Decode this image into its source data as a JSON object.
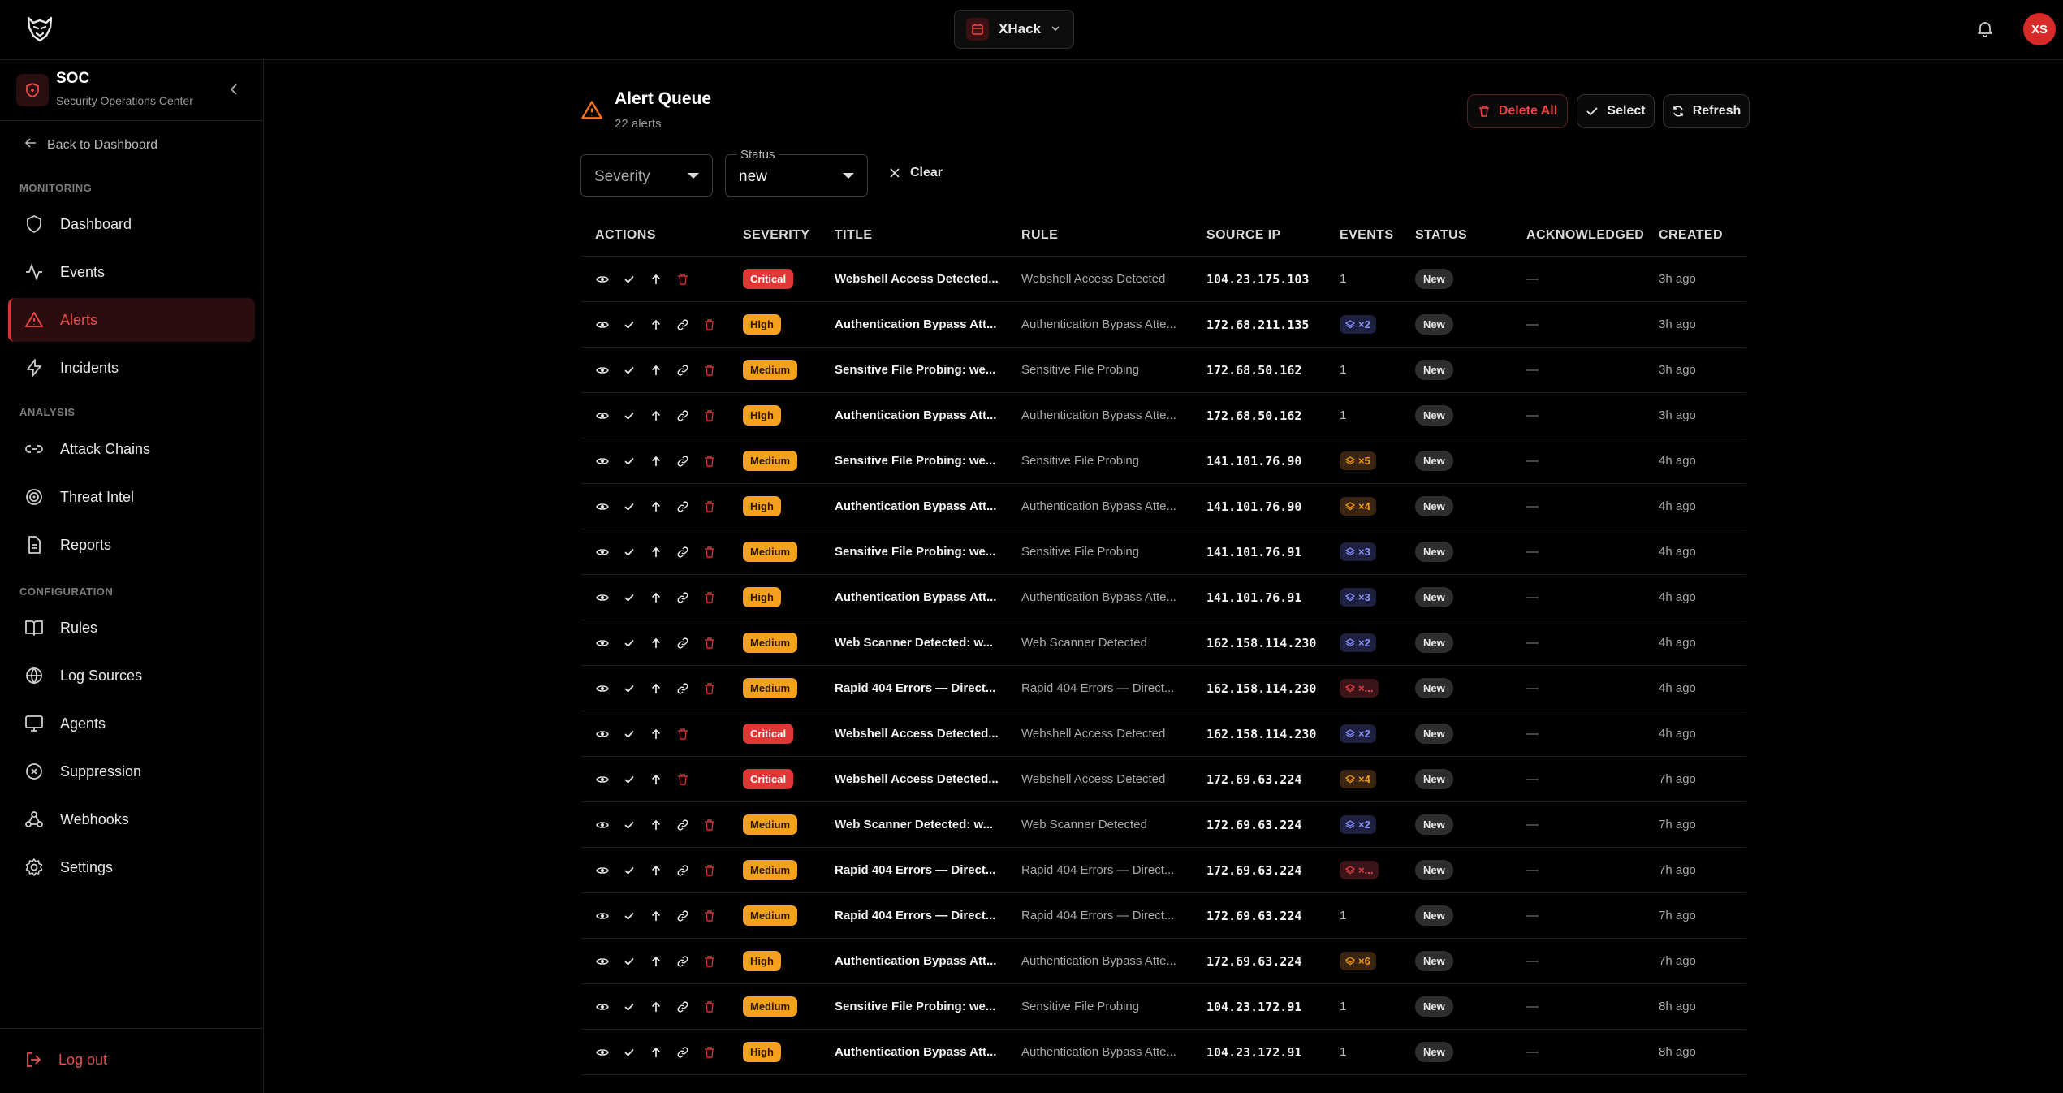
{
  "topbar": {
    "workspace_label": "XHack",
    "avatar_initials": "XS"
  },
  "sidebar": {
    "title": "SOC",
    "subtitle": "Security Operations Center",
    "back_label": "Back to Dashboard",
    "sections": {
      "monitoring": "MONITORING",
      "analysis": "ANALYSIS",
      "configuration": "CONFIGURATION"
    },
    "items": {
      "dashboard": "Dashboard",
      "events": "Events",
      "alerts": "Alerts",
      "incidents": "Incidents",
      "attack_chains": "Attack Chains",
      "threat_intel": "Threat Intel",
      "reports": "Reports",
      "rules": "Rules",
      "log_sources": "Log Sources",
      "agents": "Agents",
      "suppression": "Suppression",
      "webhooks": "Webhooks",
      "settings": "Settings"
    },
    "logout_label": "Log out",
    "accent_color": "#e03232"
  },
  "header": {
    "title": "Alert Queue",
    "count": "22 alerts",
    "delete_all_label": "Delete All",
    "select_label": "Select",
    "refresh_label": "Refresh"
  },
  "filters": {
    "severity_placeholder": "Severity",
    "status_label": "Status",
    "status_value": "new",
    "clear_label": "Clear"
  },
  "table": {
    "columns": {
      "actions": "ACTIONS",
      "severity": "SEVERITY",
      "title": "TITLE",
      "rule": "RULE",
      "source_ip": "SOURCE IP",
      "events": "EVENTS",
      "status": "STATUS",
      "acknowledged": "ACKNOWLEDGED",
      "created": "CREATED"
    },
    "rows": [
      {
        "severity": "Critical",
        "title": "Webshell Access Detected...",
        "rule": "Webshell Access Detected",
        "ip": "104.23.175.103",
        "events": "1",
        "ev_color": "",
        "status": "New",
        "ack": "—",
        "created": "3h ago",
        "link": false
      },
      {
        "severity": "High",
        "title": "Authentication Bypass Att...",
        "rule": "Authentication Bypass Atte...",
        "ip": "172.68.211.135",
        "events": "×2",
        "ev_color": "blue",
        "status": "New",
        "ack": "—",
        "created": "3h ago",
        "link": true
      },
      {
        "severity": "Medium",
        "title": "Sensitive File Probing: we...",
        "rule": "Sensitive File Probing",
        "ip": "172.68.50.162",
        "events": "1",
        "ev_color": "",
        "status": "New",
        "ack": "—",
        "created": "3h ago",
        "link": true
      },
      {
        "severity": "High",
        "title": "Authentication Bypass Att...",
        "rule": "Authentication Bypass Atte...",
        "ip": "172.68.50.162",
        "events": "1",
        "ev_color": "",
        "status": "New",
        "ack": "—",
        "created": "3h ago",
        "link": true
      },
      {
        "severity": "Medium",
        "title": "Sensitive File Probing: we...",
        "rule": "Sensitive File Probing",
        "ip": "141.101.76.90",
        "events": "×5",
        "ev_color": "orange",
        "status": "New",
        "ack": "—",
        "created": "4h ago",
        "link": true
      },
      {
        "severity": "High",
        "title": "Authentication Bypass Att...",
        "rule": "Authentication Bypass Atte...",
        "ip": "141.101.76.90",
        "events": "×4",
        "ev_color": "orange",
        "status": "New",
        "ack": "—",
        "created": "4h ago",
        "link": true
      },
      {
        "severity": "Medium",
        "title": "Sensitive File Probing: we...",
        "rule": "Sensitive File Probing",
        "ip": "141.101.76.91",
        "events": "×3",
        "ev_color": "blue",
        "status": "New",
        "ack": "—",
        "created": "4h ago",
        "link": true
      },
      {
        "severity": "High",
        "title": "Authentication Bypass Att...",
        "rule": "Authentication Bypass Atte...",
        "ip": "141.101.76.91",
        "events": "×3",
        "ev_color": "blue",
        "status": "New",
        "ack": "—",
        "created": "4h ago",
        "link": true
      },
      {
        "severity": "Medium",
        "title": "Web Scanner Detected: w...",
        "rule": "Web Scanner Detected",
        "ip": "162.158.114.230",
        "events": "×2",
        "ev_color": "blue",
        "status": "New",
        "ack": "—",
        "created": "4h ago",
        "link": true
      },
      {
        "severity": "Medium",
        "title": "Rapid 404 Errors — Direct...",
        "rule": "Rapid 404 Errors — Direct...",
        "ip": "162.158.114.230",
        "events": "×...",
        "ev_color": "red",
        "status": "New",
        "ack": "—",
        "created": "4h ago",
        "link": true
      },
      {
        "severity": "Critical",
        "title": "Webshell Access Detected...",
        "rule": "Webshell Access Detected",
        "ip": "162.158.114.230",
        "events": "×2",
        "ev_color": "blue",
        "status": "New",
        "ack": "—",
        "created": "4h ago",
        "link": false
      },
      {
        "severity": "Critical",
        "title": "Webshell Access Detected...",
        "rule": "Webshell Access Detected",
        "ip": "172.69.63.224",
        "events": "×4",
        "ev_color": "orange",
        "status": "New",
        "ack": "—",
        "created": "7h ago",
        "link": false
      },
      {
        "severity": "Medium",
        "title": "Web Scanner Detected: w...",
        "rule": "Web Scanner Detected",
        "ip": "172.69.63.224",
        "events": "×2",
        "ev_color": "blue",
        "status": "New",
        "ack": "—",
        "created": "7h ago",
        "link": true
      },
      {
        "severity": "Medium",
        "title": "Rapid 404 Errors — Direct...",
        "rule": "Rapid 404 Errors — Direct...",
        "ip": "172.69.63.224",
        "events": "×...",
        "ev_color": "red",
        "status": "New",
        "ack": "—",
        "created": "7h ago",
        "link": true
      },
      {
        "severity": "Medium",
        "title": "Rapid 404 Errors — Direct...",
        "rule": "Rapid 404 Errors — Direct...",
        "ip": "172.69.63.224",
        "events": "1",
        "ev_color": "",
        "status": "New",
        "ack": "—",
        "created": "7h ago",
        "link": true
      },
      {
        "severity": "High",
        "title": "Authentication Bypass Att...",
        "rule": "Authentication Bypass Atte...",
        "ip": "172.69.63.224",
        "events": "×6",
        "ev_color": "orange",
        "status": "New",
        "ack": "—",
        "created": "7h ago",
        "link": true
      },
      {
        "severity": "Medium",
        "title": "Sensitive File Probing: we...",
        "rule": "Sensitive File Probing",
        "ip": "104.23.172.91",
        "events": "1",
        "ev_color": "",
        "status": "New",
        "ack": "—",
        "created": "8h ago",
        "link": true
      },
      {
        "severity": "High",
        "title": "Authentication Bypass Att...",
        "rule": "Authentication Bypass Atte...",
        "ip": "104.23.172.91",
        "events": "1",
        "ev_color": "",
        "status": "New",
        "ack": "—",
        "created": "8h ago",
        "link": true
      }
    ]
  }
}
